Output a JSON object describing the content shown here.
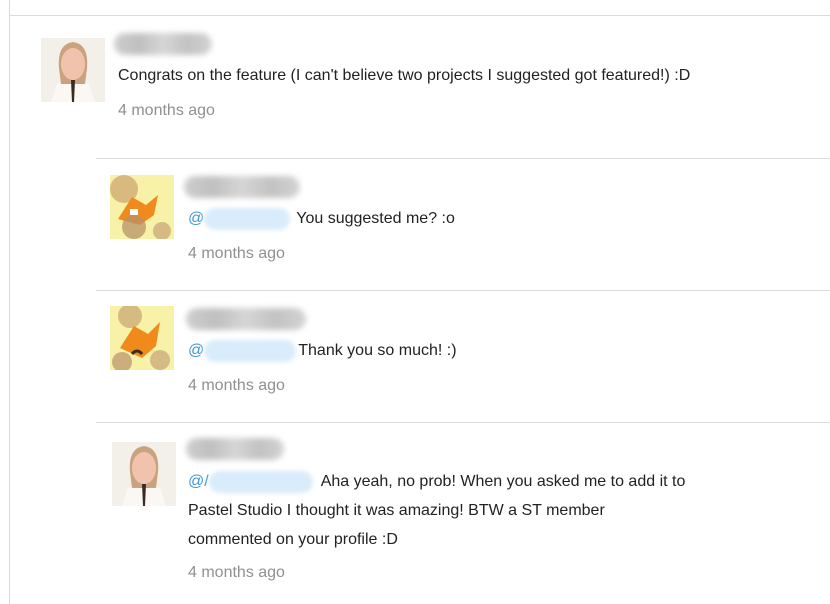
{
  "comments": [
    {
      "level": "root",
      "avatar": "person-avatar",
      "text": "Congrats on the feature (I can't believe two projects I suggested got featured!) :D",
      "time": "4 months ago"
    },
    {
      "level": "reply",
      "avatar": "fox-avatar",
      "mention_prefix": "@",
      "text": "You suggested me? :o",
      "time": "4 months ago"
    },
    {
      "level": "reply",
      "avatar": "fox-avatar",
      "mention_prefix": "@",
      "text": "Thank you so much! :)",
      "time": "4 months ago"
    },
    {
      "level": "reply",
      "avatar": "person-avatar",
      "mention_prefix": "@/",
      "text_line1": "Aha yeah, no prob! When you asked me to add it to",
      "text_line2": "Pastel Studio I thought it was amazing! BTW a ST member",
      "text_line3": "commented on your profile :D",
      "time": "4 months ago"
    }
  ],
  "colors": {
    "mention": "#3f98d6",
    "timestamp": "#909090",
    "divider": "#dcdcdc"
  }
}
